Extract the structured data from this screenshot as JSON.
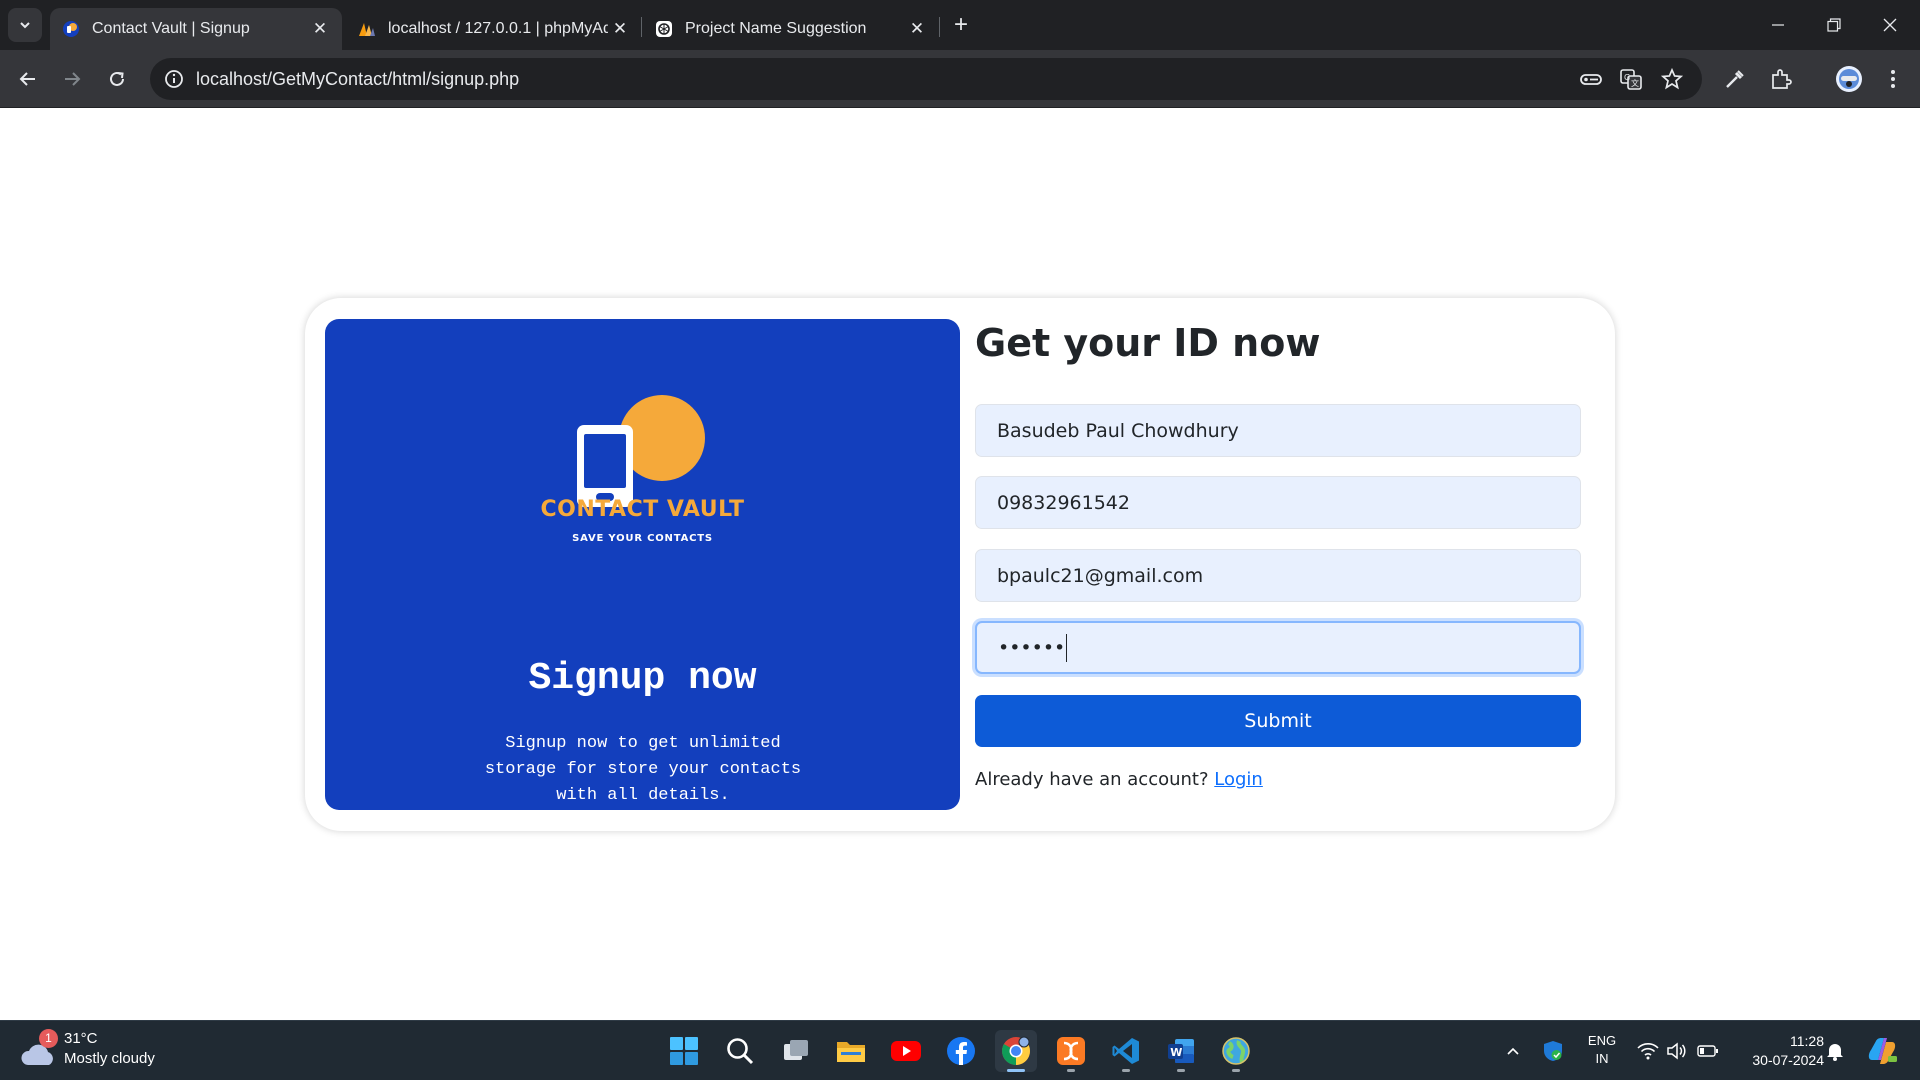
{
  "browser": {
    "tabs": [
      {
        "title": "Contact Vault | Signup",
        "active": true
      },
      {
        "title": "localhost / 127.0.0.1 | phpMyAd",
        "active": false
      },
      {
        "title": "Project Name Suggestion",
        "active": false
      }
    ],
    "url": "localhost/GetMyContact/html/signup.php",
    "new_tab": "+"
  },
  "promo": {
    "brand": "CONTACT VAULT",
    "tagline": "SAVE YOUR CONTACTS",
    "heading": "Signup now",
    "description": "Signup now to get unlimited storage for store your contacts with all details.",
    "colors": {
      "panel": "#133fbd",
      "accent": "#f5a93a"
    }
  },
  "form": {
    "heading": "Get your ID now",
    "name_value": "Basudeb Paul Chowdhury",
    "phone_value": "09832961542",
    "email_value": "bpaulc21@gmail.com",
    "password_value": "••••••",
    "submit_label": "Submit",
    "login_prompt": "Already have an account?",
    "login_link": "Login",
    "colors": {
      "button": "#0d5bd7",
      "field": "#e8f0fe"
    }
  },
  "taskbar": {
    "weather_temp": "31°C",
    "weather_cond": "Mostly cloudy",
    "weather_badge": "1",
    "lang_1": "ENG",
    "lang_2": "IN",
    "time": "11:28",
    "date": "30-07-2024",
    "apps": [
      "start-icon",
      "search-icon",
      "task-view-icon",
      "file-explorer-icon",
      "youtube-icon",
      "facebook-icon",
      "chrome-icon",
      "xampp-icon",
      "vscode-icon",
      "word-icon",
      "globe-icon"
    ]
  }
}
